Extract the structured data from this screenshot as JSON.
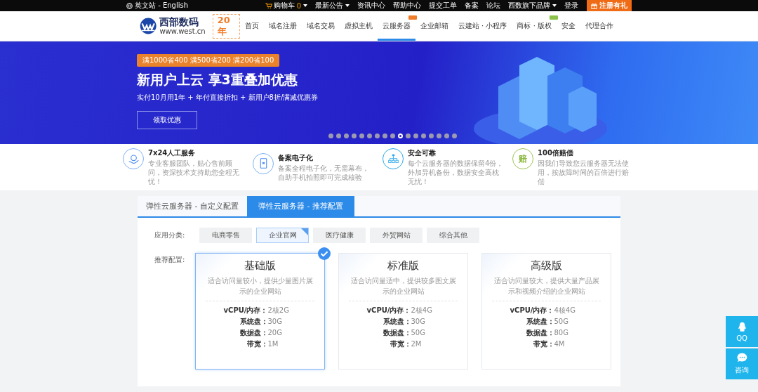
{
  "top_bar": {
    "site_switch": "英文站 - English",
    "links": [
      {
        "label": "购物车",
        "count": "0",
        "dropdown": true,
        "kind": "cart"
      },
      {
        "label": "最新公告",
        "dropdown": true,
        "kind": "text"
      },
      {
        "label": "资讯中心",
        "dropdown": false,
        "kind": "text"
      },
      {
        "label": "帮助中心",
        "dropdown": false,
        "kind": "text"
      },
      {
        "label": "提交工单",
        "dropdown": false,
        "kind": "text"
      },
      {
        "label": "备案",
        "dropdown": false,
        "kind": "text"
      },
      {
        "label": "论坛",
        "dropdown": false,
        "kind": "text"
      },
      {
        "label": "西数旗下品牌",
        "dropdown": true,
        "kind": "text"
      },
      {
        "label": "登录",
        "dropdown": false,
        "kind": "text"
      }
    ],
    "register": "注册有礼"
  },
  "header": {
    "logo": {
      "name": "西部数码",
      "url": "www.west.cn",
      "anniversary": "20年"
    },
    "nav": [
      {
        "label": "首页",
        "selected": false,
        "badge": false
      },
      {
        "label": "域名注册",
        "selected": false,
        "badge": false
      },
      {
        "label": "域名交易",
        "selected": false,
        "badge": false
      },
      {
        "label": "虚拟主机",
        "selected": false,
        "badge": false
      },
      {
        "label": "云服务器",
        "selected": true,
        "badge": true,
        "color": "#f07d2a"
      },
      {
        "label": "企业邮箱",
        "selected": false,
        "badge": false
      },
      {
        "label": "云建站 · 小程序",
        "selected": false,
        "badge": false
      },
      {
        "label": "商标 · 版权",
        "selected": false,
        "badge": true,
        "color": "#8bc34a"
      },
      {
        "label": "安全",
        "selected": false,
        "badge": false
      },
      {
        "label": "代理合作",
        "selected": false,
        "badge": false
      }
    ]
  },
  "banner": {
    "promo_tag": "满1000省400  满500省200  满200省100",
    "title": "新用户上云 享3重叠加优惠",
    "subtitle": "实付10月用1年 + 年付直接折扣 + 新用户8折/满减优惠券",
    "button": "领取优惠",
    "dots": [
      {
        "selected": false
      },
      {
        "selected": false
      },
      {
        "selected": false
      },
      {
        "selected": false
      },
      {
        "selected": false
      },
      {
        "selected": false
      },
      {
        "selected": false
      },
      {
        "selected": false
      },
      {
        "selected": false
      },
      {
        "selected": true
      },
      {
        "selected": false
      },
      {
        "selected": false
      },
      {
        "selected": false
      },
      {
        "selected": false
      },
      {
        "selected": false
      },
      {
        "selected": false
      },
      {
        "selected": false
      }
    ]
  },
  "features": [
    {
      "kind": "service",
      "title": "7x24人工服务",
      "desc": "专业客服团队，贴心售前顾问，资深技术支持助您全程无忧！"
    },
    {
      "kind": "document",
      "title": "备案电子化",
      "desc": "备案全程电子化，无需幕布，自助手机拍照即可完成核验"
    },
    {
      "kind": "network",
      "title": "安全可靠",
      "desc": "每个云服务器的数据保留4份，外加异机备份，数据安全高枕无忧！"
    },
    {
      "kind": "char",
      "icon_char": "赔",
      "title": "100倍赔偿",
      "desc": "因我们导致您云服务器无法使用，按故障时间的百倍进行赔偿"
    }
  ],
  "config": {
    "tabs": [
      {
        "label": "弹性云服务器 - 自定义配置",
        "selected": false
      },
      {
        "label": "弹性云服务器 - 推荐配置",
        "selected": true
      }
    ],
    "category_label": "应用分类:",
    "categories": [
      {
        "label": "电商零售",
        "selected": false
      },
      {
        "label": "企业官网",
        "selected": true
      },
      {
        "label": "医疗健康",
        "selected": false
      },
      {
        "label": "外贸网站",
        "selected": false
      },
      {
        "label": "综合其他",
        "selected": false
      }
    ],
    "plan_label": "推荐配置:",
    "plans": [
      {
        "name": "基础版",
        "desc": "适合访问量较小，提供少量图片展示的企业网站",
        "selected": true,
        "specs": [
          {
            "label": "vCPU/内存：",
            "value": "2核2G"
          },
          {
            "label": "系统盘：",
            "value": "30G"
          },
          {
            "label": "数据盘：",
            "value": "20G"
          },
          {
            "label": "带宽：",
            "value": "1M"
          }
        ]
      },
      {
        "name": "标准版",
        "desc": "适合访问量适中，提供较多图文展示的企业网站",
        "selected": false,
        "specs": [
          {
            "label": "vCPU/内存：",
            "value": "2核4G"
          },
          {
            "label": "系统盘：",
            "value": "30G"
          },
          {
            "label": "数据盘：",
            "value": "50G"
          },
          {
            "label": "带宽：",
            "value": "2M"
          }
        ]
      },
      {
        "name": "高级版",
        "desc": "适合访问量较大，提供大量产品展示和视频介绍的企业网站",
        "selected": false,
        "specs": [
          {
            "label": "vCPU/内存：",
            "value": "4核4G"
          },
          {
            "label": "系统盘：",
            "value": "50G"
          },
          {
            "label": "数据盘：",
            "value": "80G"
          },
          {
            "label": "带宽：",
            "value": "4M"
          }
        ]
      }
    ]
  },
  "side_buttons": [
    {
      "kind": "qq",
      "label": "QQ"
    },
    {
      "kind": "chat",
      "label": "咨询"
    }
  ]
}
